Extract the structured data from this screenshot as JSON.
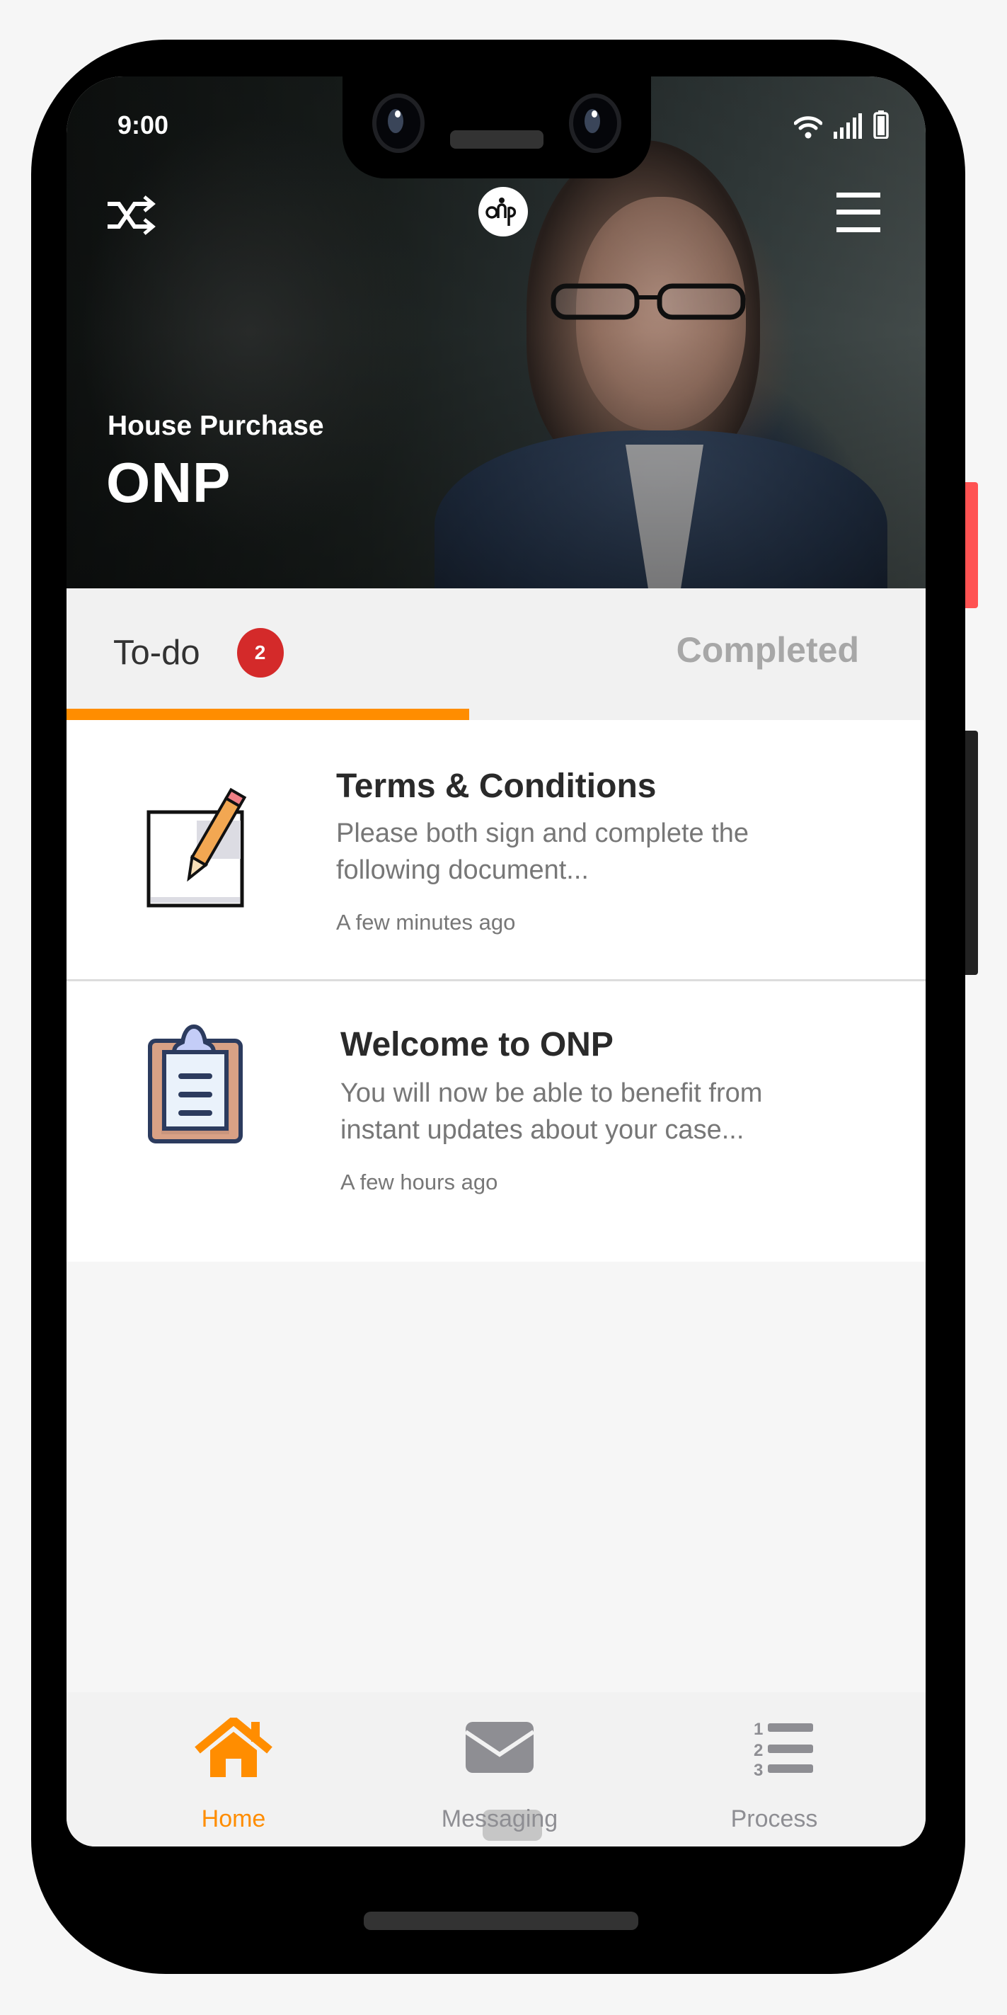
{
  "status_bar": {
    "time": "9:00",
    "icons": [
      "wifi-icon",
      "signal-icon",
      "battery-icon"
    ]
  },
  "top_bar": {
    "left_icon": "shuffle-icon",
    "logo_text": "onp",
    "right_icon": "hamburger-menu-icon"
  },
  "hero": {
    "subtitle": "House Purchase",
    "title": "ONP"
  },
  "tabs": [
    {
      "label": "To-do",
      "badge": "2",
      "active": true
    },
    {
      "label": "Completed",
      "active": false
    }
  ],
  "items": [
    {
      "icon": "document-pencil-icon",
      "title": "Terms & Conditions",
      "description": "Please both sign and complete the following document...",
      "time": "A few minutes ago"
    },
    {
      "icon": "clipboard-icon",
      "title": "Welcome to ONP",
      "description": "You will now be able to benefit from instant updates about your case...",
      "time": "A few hours ago"
    }
  ],
  "bottom_nav": [
    {
      "label": "Home",
      "icon": "home-icon",
      "active": true
    },
    {
      "label": "Messaging",
      "icon": "envelope-icon",
      "active": false
    },
    {
      "label": "Process",
      "icon": "numbered-list-icon",
      "active": false
    }
  ],
  "colors": {
    "accent": "#ff8d00",
    "badge": "#d42a2a",
    "inactive": "#8e8e93",
    "power_button": "#ff5252"
  }
}
